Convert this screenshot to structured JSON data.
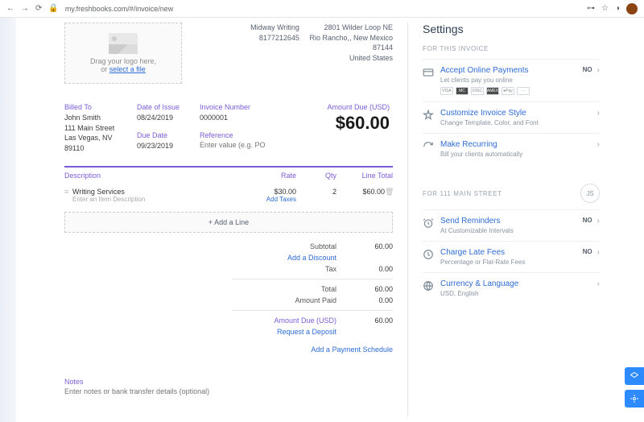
{
  "browser": {
    "url": "my.freshbooks.com/#/invoice/new"
  },
  "logo": {
    "line1": "Drag your logo here,",
    "line2_prefix": "or ",
    "link": "select a file"
  },
  "company": {
    "name": "Midway Writing",
    "phone": "8177212645",
    "addr1": "2801 Wilder Loop NE",
    "addr2": "Rio Rancho,, New Mexico",
    "zip": "87144",
    "country": "United States"
  },
  "meta": {
    "billed_to_label": "Billed To",
    "billed_to": {
      "name": "John Smith",
      "line1": "111 Main Street",
      "line2": "Las Vegas, NV",
      "zip": "89110"
    },
    "issue_label": "Date of Issue",
    "issue": "08/24/2019",
    "due_label": "Due Date",
    "due": "09/23/2019",
    "invno_label": "Invoice Number",
    "invno": "0000001",
    "ref_label": "Reference",
    "ref_placeholder": "Enter value (e.g. PO #)",
    "amount_due_label": "Amount Due (USD)",
    "amount_due": "$60.00"
  },
  "table": {
    "headers": {
      "desc": "Description",
      "rate": "Rate",
      "qty": "Qty",
      "total": "Line Total"
    },
    "lines": [
      {
        "desc": "Writing Services",
        "desc_placeholder": "Enter an Item Description",
        "rate": "$30.00",
        "add_taxes": "Add Taxes",
        "qty": "2",
        "total": "$60.00"
      }
    ],
    "add_line": "Add a Line"
  },
  "totals": {
    "subtotal_label": "Subtotal",
    "subtotal": "60.00",
    "add_discount": "Add a Discount",
    "tax_label": "Tax",
    "tax": "0.00",
    "total_label": "Total",
    "total": "60.00",
    "paid_label": "Amount Paid",
    "paid": "0.00",
    "due_label": "Amount Due (USD)",
    "due": "60.00",
    "deposit": "Request a Deposit",
    "schedule": "Add a Payment Schedule"
  },
  "notes": {
    "label": "Notes",
    "placeholder": "Enter notes or bank transfer details (optional)"
  },
  "settings": {
    "title": "Settings",
    "section1": "FOR THIS INVOICE",
    "section2": "FOR 111 MAIN STREET",
    "client_initials": "JS",
    "no_badge": "NO",
    "items": {
      "online": {
        "title": "Accept Online Payments",
        "sub": "Let clients pay you online"
      },
      "style": {
        "title": "Customize Invoice Style",
        "sub": "Change Template, Color, and Font"
      },
      "recurring": {
        "title": "Make Recurring",
        "sub": "Bill your clients automatically"
      },
      "reminders": {
        "title": "Send Reminders",
        "sub": "At Customizable Intervals"
      },
      "latefees": {
        "title": "Charge Late Fees",
        "sub": "Percentage or Flat-Rate Fees"
      },
      "currency": {
        "title": "Currency & Language",
        "sub": "USD, English"
      }
    },
    "pay_methods": [
      "VISA",
      "MC",
      "DISC",
      "AMEX",
      "●Pay",
      "···"
    ]
  }
}
